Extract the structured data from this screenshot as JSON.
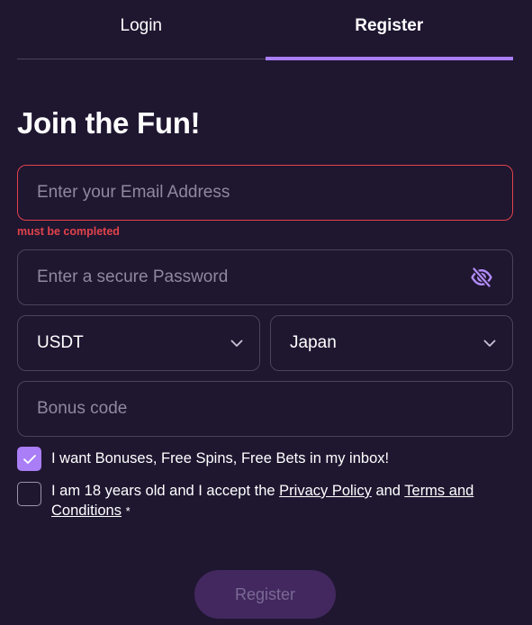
{
  "tabs": [
    {
      "label": "Login",
      "active": false
    },
    {
      "label": "Register",
      "active": true
    }
  ],
  "title": "Join the Fun!",
  "email": {
    "placeholder": "Enter your Email Address",
    "value": "",
    "error": "must be completed"
  },
  "password": {
    "placeholder": "Enter a secure Password",
    "value": "",
    "icon": "eye-slash-icon"
  },
  "currency": {
    "selected": "USDT",
    "icon": "chevron-down-icon"
  },
  "country": {
    "selected": "Japan",
    "icon": "chevron-down-icon"
  },
  "bonus_code": {
    "placeholder": "Bonus code",
    "value": ""
  },
  "bonus_opt_in": {
    "checked": true,
    "label": "I want Bonuses, Free Spins, Free Bets in my inbox!"
  },
  "terms": {
    "checked": false,
    "text_before": "I am 18 years old and I accept the ",
    "privacy_link": "Privacy Policy",
    "text_middle": " and ",
    "terms_link": "Terms and Conditions",
    "required_mark": "*"
  },
  "submit": {
    "label": "Register",
    "disabled": true
  },
  "colors": {
    "background": "#1f1630",
    "accent": "#a97ef6",
    "error": "#e0434b",
    "border": "#4b425e",
    "button_disabled_bg": "#42285f"
  }
}
